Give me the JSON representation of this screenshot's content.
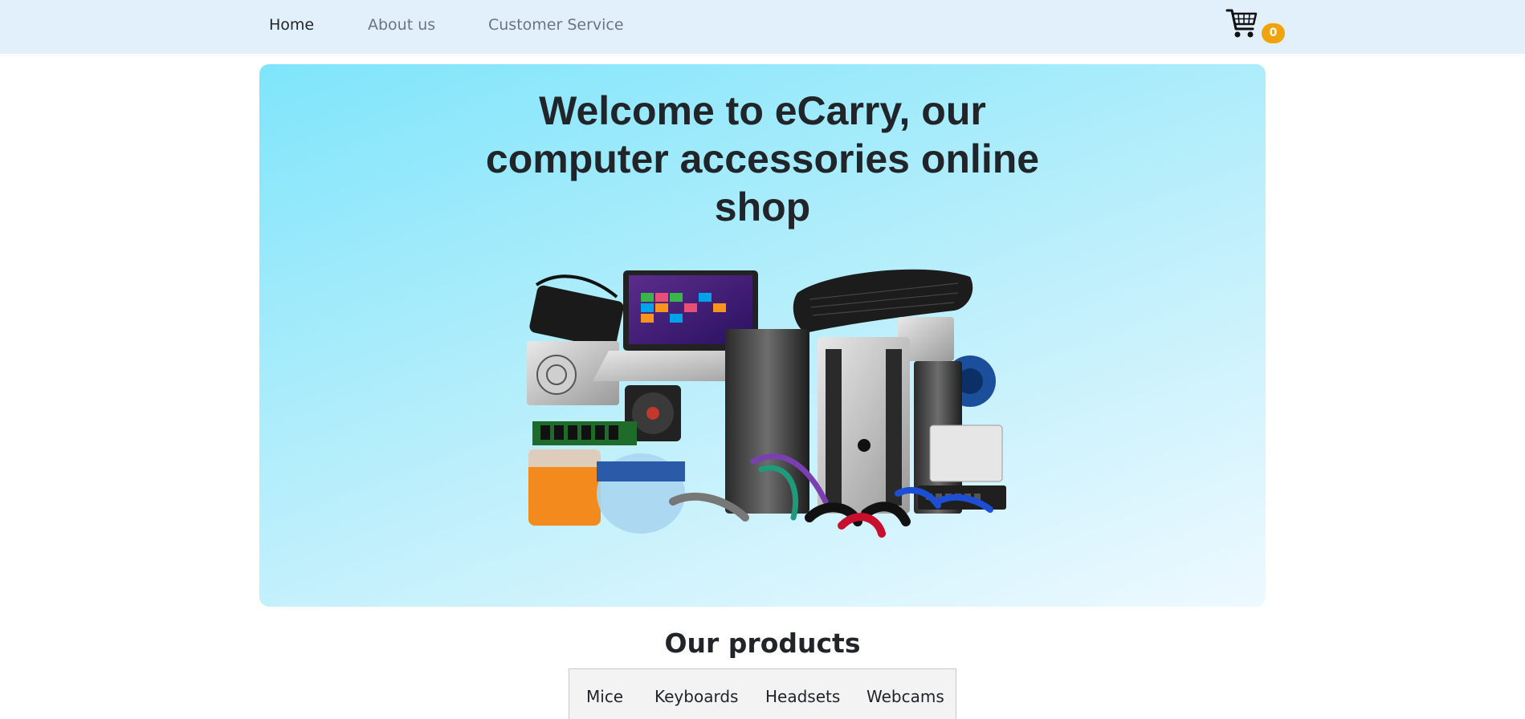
{
  "nav": {
    "home": "Home",
    "about": "About us",
    "service": "Customer Service"
  },
  "cart": {
    "icon": "shopping-cart-icon",
    "count": "0",
    "badge_color": "#f0a30a"
  },
  "hero": {
    "title_lines": [
      "Welcome to eCarry, our",
      "computer accessories online",
      "shop"
    ],
    "image": "computer-accessories-collage",
    "gradient_start": "#7fe5fb",
    "gradient_end": "#eef9ff"
  },
  "products": {
    "heading": "Our products",
    "tabs": [
      "Mice",
      "Keyboards",
      "Headsets",
      "Webcams"
    ]
  }
}
